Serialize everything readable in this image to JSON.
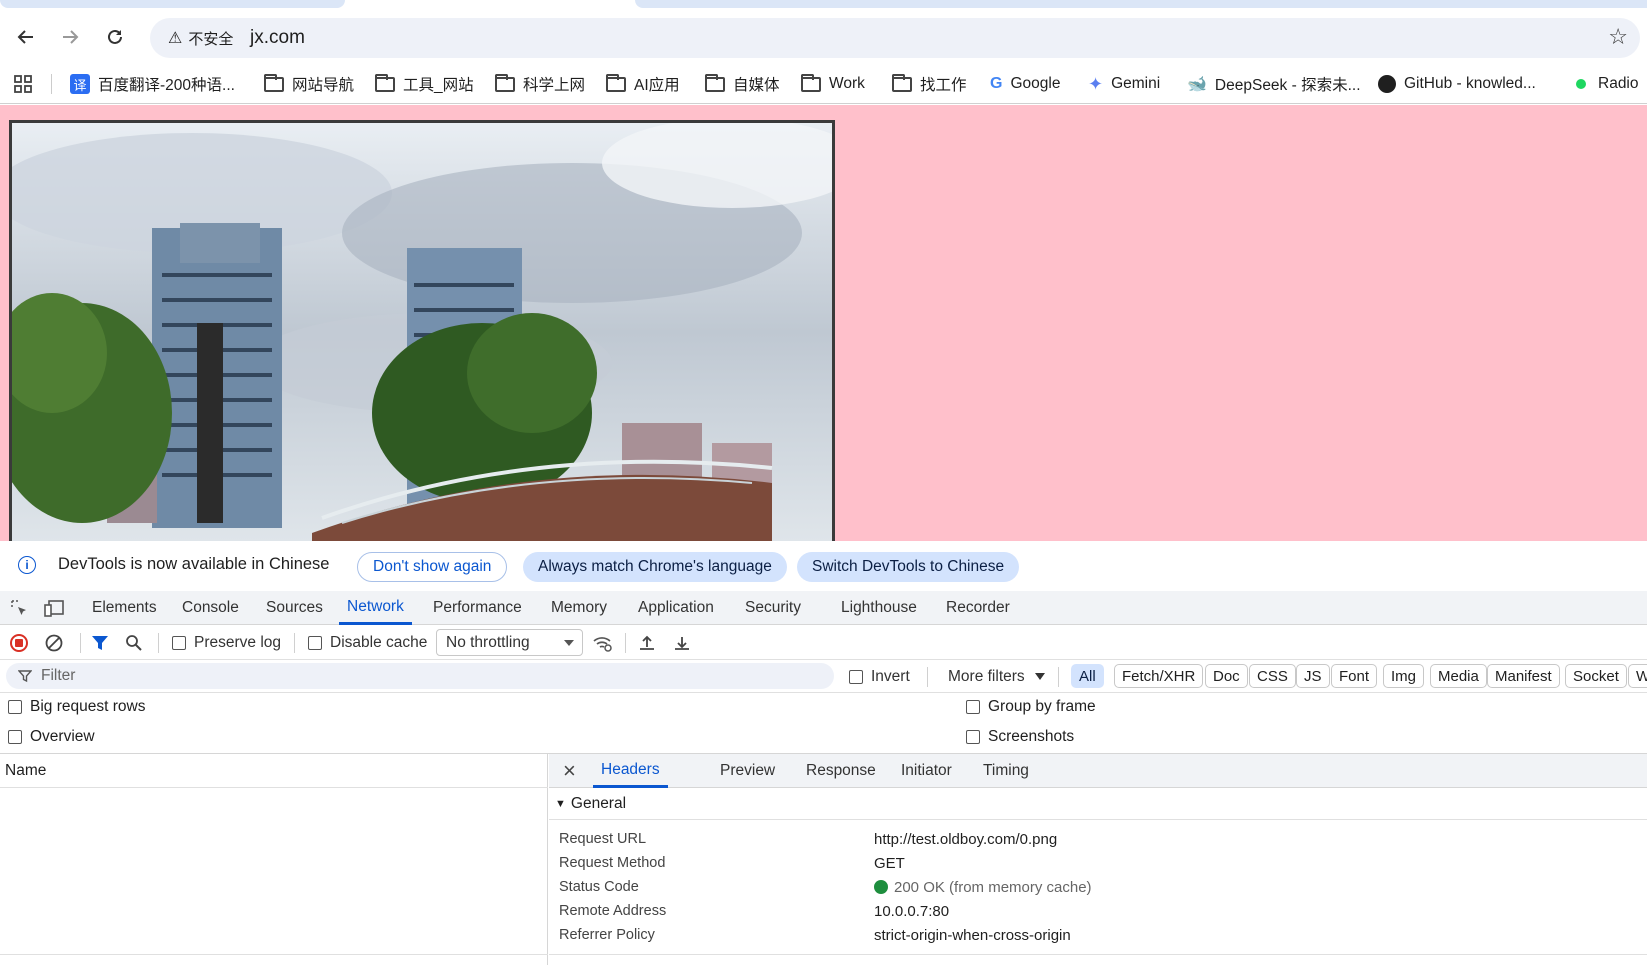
{
  "browser": {
    "address": {
      "security_label": "不安全",
      "url": "jx.com"
    },
    "bookmarks": [
      {
        "label": "百度翻译-200种语...",
        "icon": "translate-icon"
      },
      {
        "label": "网站导航",
        "icon": "folder-icon"
      },
      {
        "label": "工具_网站",
        "icon": "folder-icon"
      },
      {
        "label": "科学上网",
        "icon": "folder-icon"
      },
      {
        "label": "AI应用",
        "icon": "folder-icon"
      },
      {
        "label": "自媒体",
        "icon": "folder-icon"
      },
      {
        "label": "Work",
        "icon": "folder-icon"
      },
      {
        "label": "找工作",
        "icon": "folder-icon"
      },
      {
        "label": "Google",
        "icon": "google-icon"
      },
      {
        "label": "Gemini",
        "icon": "gemini-icon"
      },
      {
        "label": "DeepSeek - 探索未...",
        "icon": "deepseek-icon"
      },
      {
        "label": "GitHub - knowled...",
        "icon": "github-icon"
      },
      {
        "label": "Radio",
        "icon": "radio-icon"
      }
    ]
  },
  "page": {
    "background": "#ffc0cb"
  },
  "devtools": {
    "banner": {
      "message": "DevTools is now available in Chinese",
      "dont_show": "Don't show again",
      "always_match": "Always match Chrome's language",
      "switch": "Switch DevTools to Chinese"
    },
    "tabs": [
      "Elements",
      "Console",
      "Sources",
      "Network",
      "Performance",
      "Memory",
      "Application",
      "Security",
      "Lighthouse",
      "Recorder"
    ],
    "active_tab": "Network",
    "toolbar": {
      "preserve_log": "Preserve log",
      "disable_cache": "Disable cache",
      "throttling": "No throttling"
    },
    "filter": {
      "placeholder": "Filter",
      "invert": "Invert",
      "more_filters": "More filters",
      "chips": [
        "All",
        "Fetch/XHR",
        "Doc",
        "CSS",
        "JS",
        "Font",
        "Img",
        "Media",
        "Manifest",
        "Socket",
        "W"
      ]
    },
    "options": {
      "big_rows": "Big request rows",
      "overview": "Overview",
      "group_by_frame": "Group by frame",
      "screenshots": "Screenshots"
    },
    "name_header": "Name",
    "detail_tabs": [
      "Headers",
      "Preview",
      "Response",
      "Initiator",
      "Timing"
    ],
    "general": {
      "title": "General",
      "rows": [
        {
          "key": "Request URL",
          "value": "http://test.oldboy.com/0.png"
        },
        {
          "key": "Request Method",
          "value": "GET"
        },
        {
          "key": "Status Code",
          "value": "200 OK (from memory cache)"
        },
        {
          "key": "Remote Address",
          "value": "10.0.0.7:80"
        },
        {
          "key": "Referrer Policy",
          "value": "strict-origin-when-cross-origin"
        }
      ]
    }
  }
}
